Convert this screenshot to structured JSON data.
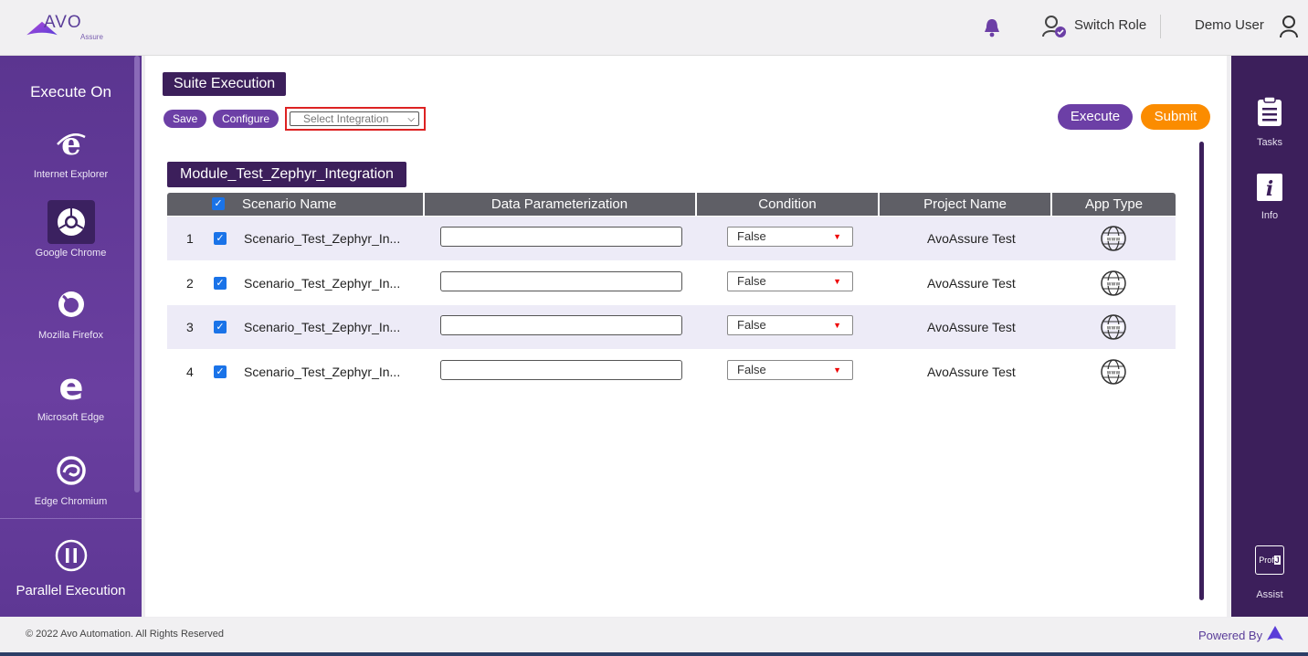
{
  "header": {
    "logo_text": "AVO",
    "logo_sub": "Assure",
    "switch_role": "Switch Role",
    "user": "Demo User"
  },
  "sidebar": {
    "title": "Execute On",
    "browsers": [
      {
        "label": "Internet Explorer",
        "icon": "internet-explorer-icon"
      },
      {
        "label": "Google Chrome",
        "icon": "chrome-icon",
        "selected": true
      },
      {
        "label": "Mozilla Firefox",
        "icon": "firefox-icon"
      },
      {
        "label": "Microsoft Edge",
        "icon": "edge-icon"
      },
      {
        "label": "Edge Chromium",
        "icon": "edge-chromium-icon"
      }
    ],
    "parallel": "Parallel Execution"
  },
  "main": {
    "title": "Suite Execution",
    "save": "Save",
    "configure": "Configure",
    "integration_placeholder": "Select Integration",
    "execute": "Execute",
    "submit": "Submit",
    "module": "Module_Test_Zephyr_Integration",
    "columns": [
      "Scenario Name",
      "Data Parameterization",
      "Condition",
      "Project Name",
      "App Type"
    ],
    "rows": [
      {
        "num": "1",
        "scenario": "Scenario_Test_Zephyr_In...",
        "condition": "False",
        "project": "AvoAssure Test",
        "app_type": "web"
      },
      {
        "num": "2",
        "scenario": "Scenario_Test_Zephyr_In...",
        "condition": "False",
        "project": "AvoAssure Test",
        "app_type": "web"
      },
      {
        "num": "3",
        "scenario": "Scenario_Test_Zephyr_In...",
        "condition": "False",
        "project": "AvoAssure Test",
        "app_type": "web"
      },
      {
        "num": "4",
        "scenario": "Scenario_Test_Zephyr_In...",
        "condition": "False",
        "project": "AvoAssure Test",
        "app_type": "web"
      }
    ]
  },
  "right_sidebar": {
    "tasks": "Tasks",
    "info": "Info",
    "assist": "Assist",
    "assist_badge": "Prof"
  },
  "footer": {
    "copyright": "© 2022 Avo Automation. All Rights Reserved",
    "powered": "Powered By"
  },
  "colors": {
    "brand_purple": "#6c3fa6",
    "dark_purple": "#3c1f5b",
    "submit_orange": "#fb8c00"
  }
}
